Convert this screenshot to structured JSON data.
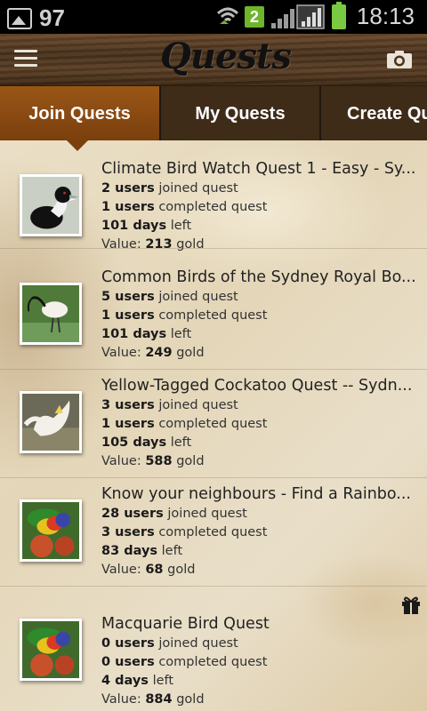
{
  "status_bar": {
    "notification_count": "97",
    "badge": "2",
    "time": "18:13",
    "icons": [
      "image-notification-icon",
      "wifi-icon",
      "signal-icon",
      "battery-icon"
    ]
  },
  "app_bar": {
    "title": "Quests",
    "menu_icon": "menu-icon",
    "camera_icon": "camera-icon"
  },
  "tabs": [
    {
      "label": "Join Quests",
      "active": true
    },
    {
      "label": "My Quests",
      "active": false
    },
    {
      "label": "Create Qu",
      "active": false
    }
  ],
  "labels": {
    "joined": "joined quest",
    "completed": "completed quest",
    "left": "left",
    "value_prefix": "Value:",
    "gold": "gold"
  },
  "quests": [
    {
      "title": "Climate Bird Watch Quest 1 - Easy - Sy...",
      "users_joined": "2 users",
      "users_completed": "1 users",
      "days_left": "101 days",
      "value": "213",
      "image": "magpie"
    },
    {
      "title": "Common Birds of the Sydney Royal Bo...",
      "users_joined": "5 users",
      "users_completed": "1 users",
      "days_left": "101 days",
      "value": "249",
      "image": "ibis"
    },
    {
      "title": "Yellow-Tagged Cockatoo Quest -- Sydn...",
      "users_joined": "3 users",
      "users_completed": "1 users",
      "days_left": "105 days",
      "value": "588",
      "image": "cockatoo"
    },
    {
      "title": "Know your neighbours - Find a Rainbo...",
      "users_joined": "28 users",
      "users_completed": "3 users",
      "days_left": "83 days",
      "value": "68",
      "image": "lorikeet"
    },
    {
      "title": "Macquarie Bird Quest",
      "users_joined": "0 users",
      "users_completed": "0 users",
      "days_left": "4 days",
      "value": "884",
      "image": "lorikeet"
    }
  ],
  "colors": {
    "active_tab": "#8a4a12",
    "tab_bg": "#3e2c19",
    "parchment": "#e6d9bd",
    "badge_green": "#6fb52c"
  }
}
